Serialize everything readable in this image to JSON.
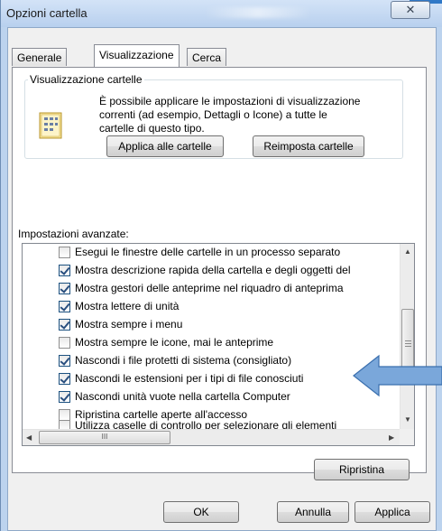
{
  "window": {
    "title": "Opzioni cartella",
    "close_glyph": "✕"
  },
  "tabs": [
    {
      "label": "Generale",
      "active": false
    },
    {
      "label": "Visualizzazione",
      "active": true
    },
    {
      "label": "Cerca",
      "active": false
    }
  ],
  "folder_view": {
    "legend": "Visualizzazione cartelle",
    "description_lines": [
      "È possibile applicare le impostazioni di visualizzazione",
      "correnti (ad esempio, Dettagli o Icone) a tutte le",
      "cartelle di questo tipo."
    ],
    "apply_label": "Applica alle cartelle",
    "reset_label": "Reimposta cartelle",
    "icon": "folder-view-icon"
  },
  "advanced": {
    "label": "Impostazioni avanzate:",
    "items": [
      {
        "label": "Esegui le finestre delle cartelle in un processo separato",
        "checked": false
      },
      {
        "label": "Mostra descrizione rapida della cartella e degli oggetti del",
        "checked": true
      },
      {
        "label": "Mostra gestori delle anteprime nel riquadro di anteprima",
        "checked": true
      },
      {
        "label": "Mostra lettere di unità",
        "checked": true
      },
      {
        "label": "Mostra sempre i menu",
        "checked": true
      },
      {
        "label": "Mostra sempre le icone, mai le anteprime",
        "checked": false
      },
      {
        "label": "Nascondi i file protetti di sistema (consigliato)",
        "checked": true
      },
      {
        "label": "Nascondi le estensioni per i tipi di file conosciuti",
        "checked": true
      },
      {
        "label": "Nascondi unità vuote nella cartella Computer",
        "checked": true
      },
      {
        "label": "Ripristina cartelle aperte all'accesso",
        "checked": false
      },
      {
        "label": "Utilizza caselle di controllo per selezionare gli elementi",
        "checked": false
      }
    ],
    "scroll_up": "▲",
    "scroll_down": "▼",
    "scroll_left": "◀",
    "scroll_right": "▶",
    "hthumb_grip": "III",
    "restore_label": "Ripristina"
  },
  "footer": {
    "ok_label": "OK",
    "cancel_label": "Annulla",
    "apply_label": "Applica"
  },
  "colors": {
    "annotation_arrow": "#7aa7da",
    "accent": "#2f78c7"
  }
}
